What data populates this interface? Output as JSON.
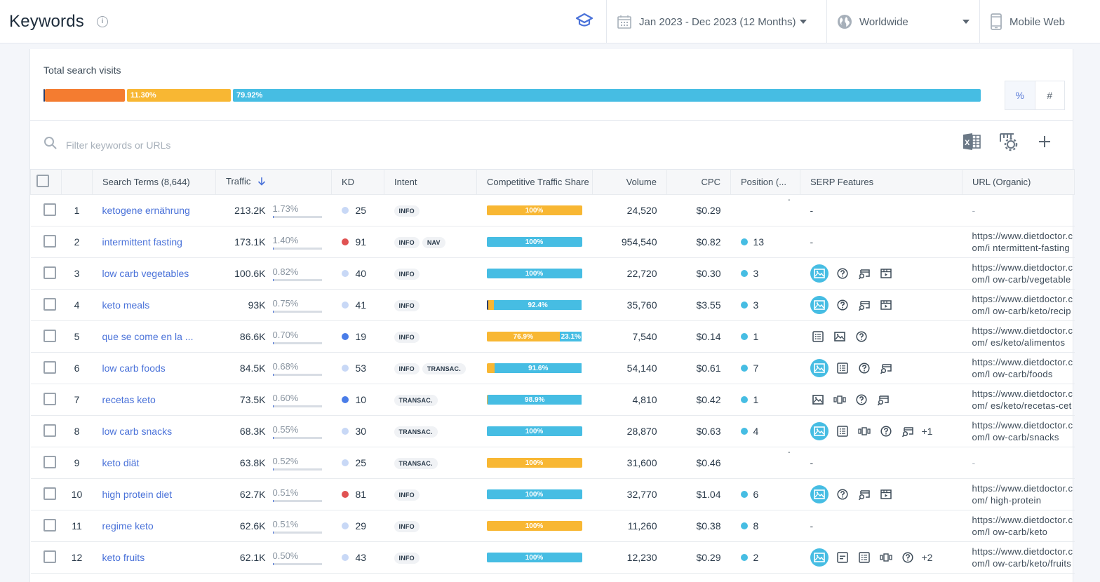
{
  "header": {
    "title": "Keywords",
    "date_range": "Jan 2023 - Dec 2023 (12 Months)",
    "region": "Worldwide",
    "device": "Mobile Web"
  },
  "total_search_visits": {
    "label": "Total search visits",
    "segments": [
      {
        "label": "",
        "percent": 8.78,
        "color": "#f47c30"
      },
      {
        "label": "11.30%",
        "percent": 11.3,
        "color": "#f8b733"
      },
      {
        "label": "79.92%",
        "percent": 79.92,
        "color": "#46bde3"
      }
    ],
    "toggle": {
      "percent": "%",
      "number": "#"
    }
  },
  "filter": {
    "placeholder": "Filter keywords or URLs"
  },
  "colors": {
    "accent": "#4a72d9",
    "orange": "#f47c30",
    "yellow": "#f8b733",
    "cyan": "#46bde3",
    "kd_easy": "#c8d8f6",
    "kd_mid": "#4a7de8",
    "kd_hard": "#e05252"
  },
  "table": {
    "columns": [
      "",
      "",
      "Search Terms (8,644)",
      "Traffic",
      "KD",
      "Intent",
      "Competitive Traffic Share",
      "Volume",
      "CPC",
      "Position (...",
      "SERP Features",
      "URL (Organic)"
    ],
    "rows": [
      {
        "n": "1",
        "term": "ketogene ernährung",
        "traffic": "213.2K",
        "share": "1.73%",
        "share_v": 1.73,
        "kd": "25",
        "kd_c": "easy",
        "intent": [
          "INFO"
        ],
        "cts": [
          {
            "p": 100,
            "c": "yellow",
            "l": "100%"
          }
        ],
        "volume": "24,520",
        "cpc": "$0.29",
        "pos": "",
        "serp": [],
        "serp_more": "",
        "serp_dash": true,
        "url": "-"
      },
      {
        "n": "2",
        "term": "intermittent fasting",
        "traffic": "173.1K",
        "share": "1.40%",
        "share_v": 1.4,
        "kd": "91",
        "kd_c": "hard",
        "intent": [
          "INFO",
          "NAV"
        ],
        "cts": [
          {
            "p": 100,
            "c": "cyan",
            "l": "100%"
          }
        ],
        "volume": "954,540",
        "cpc": "$0.82",
        "pos": "13",
        "serp": [],
        "serp_more": "",
        "serp_dash": true,
        "url": "https://www.dietdoctor.com/i ntermittent-fasting"
      },
      {
        "n": "3",
        "term": "low carb vegetables",
        "traffic": "100.6K",
        "share": "0.82%",
        "share_v": 0.82,
        "kd": "40",
        "kd_c": "easy",
        "intent": [
          "INFO"
        ],
        "cts": [
          {
            "p": 100,
            "c": "cyan",
            "l": "100%"
          }
        ],
        "volume": "22,720",
        "cpc": "$0.30",
        "pos": "3",
        "serp": [
          "image-hl",
          "question",
          "local",
          "video"
        ],
        "serp_more": "",
        "serp_dash": false,
        "url": "https://www.dietdoctor.com/l ow-carb/vegetables"
      },
      {
        "n": "4",
        "term": "keto meals",
        "traffic": "93K",
        "share": "0.75%",
        "share_v": 0.75,
        "kd": "41",
        "kd_c": "easy",
        "intent": [
          "INFO"
        ],
        "cts": [
          {
            "p": 1.5,
            "c": "navy",
            "l": ""
          },
          {
            "p": 6.1,
            "c": "yellow",
            "l": ""
          },
          {
            "p": 92.4,
            "c": "cyan",
            "l": "92.4%"
          }
        ],
        "volume": "35,760",
        "cpc": "$3.55",
        "pos": "3",
        "serp": [
          "image-hl",
          "question",
          "local",
          "video"
        ],
        "serp_more": "",
        "serp_dash": false,
        "url": "https://www.dietdoctor.com/l ow-carb/keto/recipes/meals"
      },
      {
        "n": "5",
        "term": "que se come en la ...",
        "traffic": "86.6K",
        "share": "0.70%",
        "share_v": 0.7,
        "kd": "19",
        "kd_c": "mid",
        "intent": [
          "INFO"
        ],
        "cts": [
          {
            "p": 76.9,
            "c": "yellow",
            "l": "76.9%"
          },
          {
            "p": 23.1,
            "c": "cyan",
            "l": "23.1%"
          }
        ],
        "volume": "7,540",
        "cpc": "$0.14",
        "pos": "1",
        "serp": [
          "list",
          "image",
          "question"
        ],
        "serp_more": "",
        "serp_dash": false,
        "url": "https://www.dietdoctor.com/ es/keto/alimentos"
      },
      {
        "n": "6",
        "term": "low carb foods",
        "traffic": "84.5K",
        "share": "0.68%",
        "share_v": 0.68,
        "kd": "53",
        "kd_c": "easy",
        "intent": [
          "INFO",
          "TRANSAC."
        ],
        "cts": [
          {
            "p": 8.4,
            "c": "yellow",
            "l": ""
          },
          {
            "p": 91.6,
            "c": "cyan",
            "l": "91.6%"
          }
        ],
        "volume": "54,140",
        "cpc": "$0.61",
        "pos": "7",
        "serp": [
          "image-hl",
          "list",
          "question",
          "local"
        ],
        "serp_more": "",
        "serp_dash": false,
        "url": "https://www.dietdoctor.com/l ow-carb/foods"
      },
      {
        "n": "7",
        "term": "recetas keto",
        "traffic": "73.5K",
        "share": "0.60%",
        "share_v": 0.6,
        "kd": "10",
        "kd_c": "mid",
        "intent": [
          "TRANSAC."
        ],
        "cts": [
          {
            "p": 1.1,
            "c": "yellow",
            "l": ""
          },
          {
            "p": 98.9,
            "c": "cyan",
            "l": "98.9%"
          }
        ],
        "volume": "4,810",
        "cpc": "$0.42",
        "pos": "1",
        "serp": [
          "image",
          "carousel",
          "question",
          "local"
        ],
        "serp_more": "",
        "serp_dash": false,
        "url": "https://www.dietdoctor.com/ es/keto/recetas-cetogenicas"
      },
      {
        "n": "8",
        "term": "low carb snacks",
        "traffic": "68.3K",
        "share": "0.55%",
        "share_v": 0.55,
        "kd": "30",
        "kd_c": "easy",
        "intent": [
          "TRANSAC."
        ],
        "cts": [
          {
            "p": 100,
            "c": "cyan",
            "l": "100%"
          }
        ],
        "volume": "28,870",
        "cpc": "$0.63",
        "pos": "4",
        "serp": [
          "image-hl",
          "list",
          "carousel",
          "question",
          "local"
        ],
        "serp_more": "+1",
        "serp_dash": false,
        "url": "https://www.dietdoctor.com/l ow-carb/snacks"
      },
      {
        "n": "9",
        "term": "keto diät",
        "traffic": "63.8K",
        "share": "0.52%",
        "share_v": 0.52,
        "kd": "25",
        "kd_c": "easy",
        "intent": [
          "TRANSAC."
        ],
        "cts": [
          {
            "p": 100,
            "c": "yellow",
            "l": "100%"
          }
        ],
        "volume": "31,600",
        "cpc": "$0.46",
        "pos": "",
        "serp": [],
        "serp_more": "",
        "serp_dash": true,
        "url": "-"
      },
      {
        "n": "10",
        "term": "high protein diet",
        "traffic": "62.7K",
        "share": "0.51%",
        "share_v": 0.51,
        "kd": "81",
        "kd_c": "hard",
        "intent": [
          "INFO"
        ],
        "cts": [
          {
            "p": 100,
            "c": "cyan",
            "l": "100%"
          }
        ],
        "volume": "32,770",
        "cpc": "$1.04",
        "pos": "6",
        "serp": [
          "image-hl",
          "question",
          "local",
          "video"
        ],
        "serp_more": "",
        "serp_dash": false,
        "url": "https://www.dietdoctor.com/ high-protein"
      },
      {
        "n": "11",
        "term": "regime keto",
        "traffic": "62.6K",
        "share": "0.51%",
        "share_v": 0.51,
        "kd": "29",
        "kd_c": "easy",
        "intent": [
          "INFO"
        ],
        "cts": [
          {
            "p": 100,
            "c": "yellow",
            "l": "100%"
          }
        ],
        "volume": "11,260",
        "cpc": "$0.38",
        "pos": "8",
        "serp": [],
        "serp_more": "",
        "serp_dash": true,
        "url": "https://www.dietdoctor.com/l ow-carb/keto"
      },
      {
        "n": "12",
        "term": "keto fruits",
        "traffic": "62.1K",
        "share": "0.50%",
        "share_v": 0.5,
        "kd": "43",
        "kd_c": "easy",
        "intent": [
          "INFO"
        ],
        "cts": [
          {
            "p": 100,
            "c": "cyan",
            "l": "100%"
          }
        ],
        "volume": "12,230",
        "cpc": "$0.29",
        "pos": "2",
        "serp": [
          "image-hl",
          "snippet",
          "list",
          "carousel",
          "question"
        ],
        "serp_more": "+2",
        "serp_dash": false,
        "url": "https://www.dietdoctor.com/l ow-carb/keto/fruits"
      }
    ]
  }
}
